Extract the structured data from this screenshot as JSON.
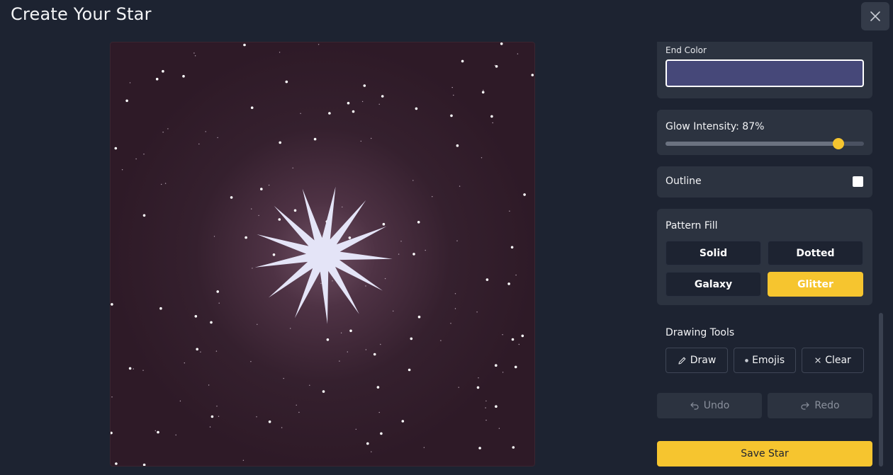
{
  "title": "Create Your Star",
  "close_icon": "close-icon",
  "canvas": {
    "background_color": "#2e1a27",
    "glow_color": "#6a4a5c",
    "star_color": "#e4e4f7",
    "star_points": 13
  },
  "panel": {
    "end_color": {
      "label": "End Color",
      "value": "#464879"
    },
    "glow": {
      "label": "Glow Intensity: 87%",
      "value": 87
    },
    "outline": {
      "label": "Outline",
      "checked": false
    },
    "pattern": {
      "label": "Pattern Fill",
      "options": [
        "Solid",
        "Dotted",
        "Galaxy",
        "Glitter"
      ],
      "selected": "Glitter"
    },
    "tools": {
      "label": "Drawing Tools",
      "draw": "Draw",
      "emojis": "Emojis",
      "clear": "Clear"
    },
    "undo": "Undo",
    "redo": "Redo",
    "save": "Save Star"
  },
  "colors": {
    "accent": "#f6c52f",
    "background": "#1d2331",
    "card": "#2c3340"
  }
}
